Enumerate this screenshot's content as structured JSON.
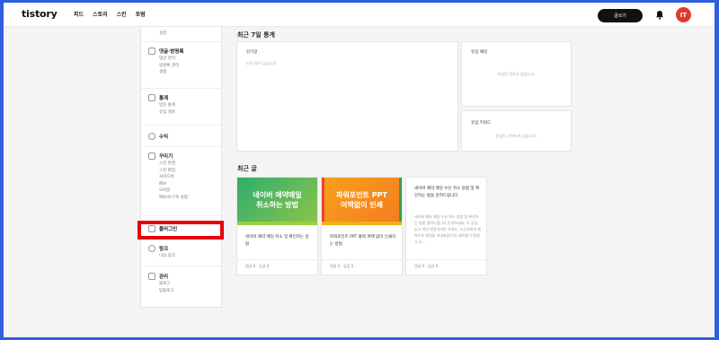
{
  "header": {
    "logo": "tistory",
    "nav": [
      "피드",
      "스토리",
      "스킨",
      "포럼"
    ],
    "write_button": "글쓰기",
    "avatar_text": "IT"
  },
  "sidebar": {
    "top_item": "설정",
    "groups": [
      {
        "title": "댓글·방명록",
        "items": [
          "댓글 관리",
          "방명록 관리",
          "설정"
        ]
      },
      {
        "title": "통계",
        "items": [
          "방문 통계",
          "유입 경로"
        ]
      },
      {
        "title": "수익",
        "items": []
      },
      {
        "title": "꾸미기",
        "items": [
          "스킨 변경",
          "스킨 편집",
          "사이드바",
          "메뉴",
          "모바일",
          "메뉴바/구독 설정"
        ]
      },
      {
        "title": "플러그인",
        "items": []
      },
      {
        "title": "링크",
        "items": [
          "나의 링크"
        ]
      },
      {
        "title": "관리",
        "items": [
          "블로그",
          "팀블로그"
        ]
      }
    ]
  },
  "stats": {
    "title": "최근 7일 통계",
    "popular": {
      "label": "인기글",
      "empty": "인기 글이 없습니다."
    },
    "channel": {
      "label": "유입 채널",
      "empty": "유입된 경로가 없습니다."
    },
    "keyword": {
      "label": "유입 키워드",
      "empty": "유입된 키워드가 없습니다."
    }
  },
  "recent": {
    "title": "최근 글",
    "posts": [
      {
        "thumb": "네이버 예약메일\n취소하는 방법",
        "title": "네이버 예약 메일 취소 및 확인하는 방법",
        "meta": "댓글 0 · 공감 0"
      },
      {
        "thumb": "파워포인트 PPT\n여백없이 인쇄",
        "title": "파워포인트 PPT 출력 여백 없이 인쇄하는 방법",
        "meta": "댓글 0 · 공감 0"
      },
      {
        "title": "네이버 예약 메일 수신 취소 방법 및 확인하는 법을 알려드립니다",
        "excerpt": "네이버 예약 메일 수신 취소 방법 및 확인하는 법을 알려드립니다 안녕하세요, 더 궁금 있고 개선 현장이라면 아마도, 누군가에게 예약으로 메일을 보내놓았는데, 예약을 수정해서 다...",
        "meta": "댓글 0 · 공감 0"
      }
    ]
  }
}
